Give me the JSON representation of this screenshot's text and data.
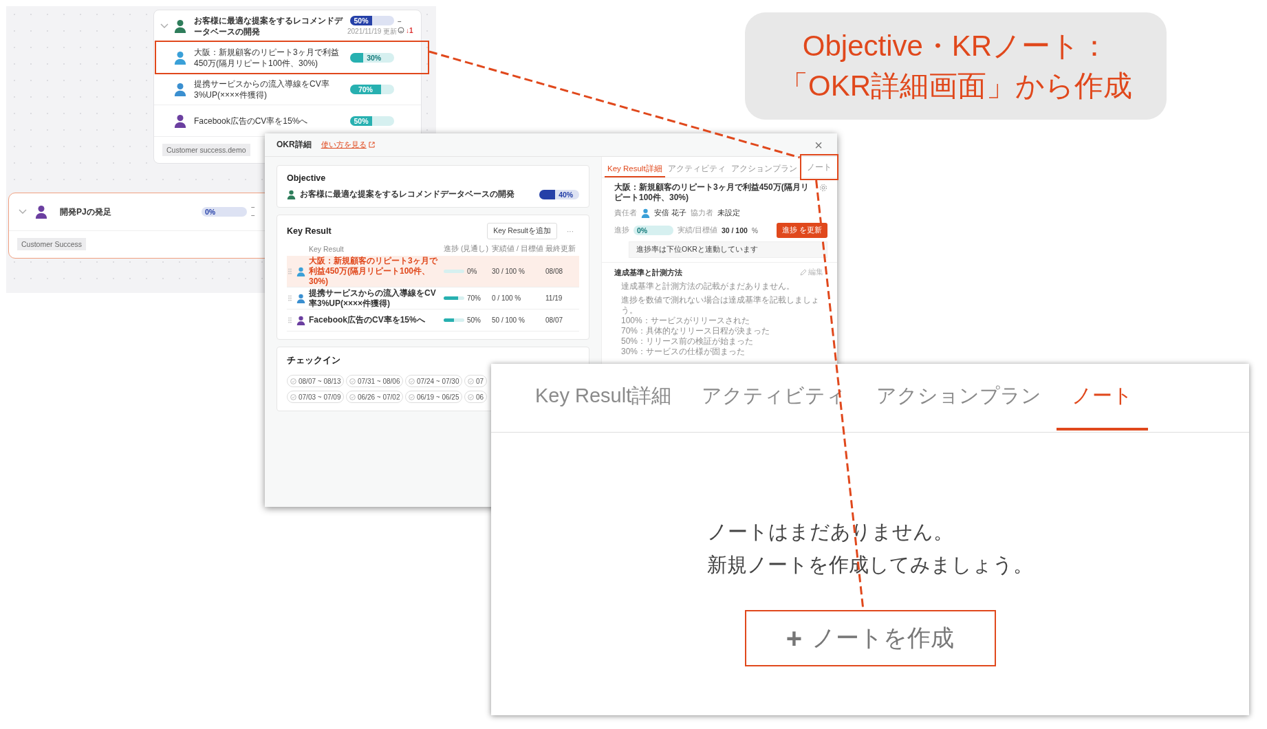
{
  "tree": {
    "objective": {
      "expanded": true,
      "color": "#2e7d5b",
      "title": "お客様に最適な提案をするレコメンドデータベースの開発",
      "progress": "50%",
      "level": 0.5,
      "updated": "2021/11/19 更新",
      "dash": "−",
      "trend": "↓1"
    },
    "key_results": [
      {
        "color": "#3aa0d8",
        "title": "大阪：新規顧客のリピート3ヶ月で利益450万(隔月リピート100件、30%)",
        "progress": "30%",
        "level": 0.3,
        "highlighted": true
      },
      {
        "color": "#3a8fd0",
        "title": "提携サービスからの流入導線をCV率3%UP(××××件獲得)",
        "progress": "70%",
        "level": 0.7,
        "highlighted": false
      },
      {
        "color": "#6b3fa0",
        "title": "Facebook広告のCV率を15%へ",
        "progress": "50%",
        "level": 0.5,
        "highlighted": false
      }
    ],
    "tag": "Customer success.demo"
  },
  "project": {
    "expanded": true,
    "color": "#6b3fa0",
    "title": "開発PJの発足",
    "progress": "0%",
    "level": 0,
    "dashes": [
      "−",
      "−"
    ],
    "tag": "Customer Success"
  },
  "modal": {
    "title": "OKR詳細",
    "help_link": "使い方を見る",
    "close": "×",
    "objective": {
      "heading": "Objective",
      "color": "#2e7d5b",
      "title": "お客様に最適な提案をするレコメンドデータベースの開発",
      "progress": "40%",
      "level": 0.4
    },
    "key_result": {
      "heading": "Key Result",
      "add_button": "Key Resultを追加",
      "more": "···",
      "columns": [
        "Key Result",
        "進捗 (見通し)",
        "実績値 / 目標値",
        "最終更新"
      ],
      "rows": [
        {
          "selected": true,
          "color": "#3aa0d8",
          "title": "大阪：新規顧客のリピート3ヶ月で利益450万(隔月リピート100件、30%)",
          "progress": "0%",
          "level": 0,
          "actual": "30 / 100 %",
          "updated": "08/08"
        },
        {
          "selected": false,
          "color": "#3a8fd0",
          "title": "提携サービスからの流入導線をCV率3%UP(××××件獲得)",
          "progress": "70%",
          "level": 0.7,
          "actual": "0 / 100 %",
          "updated": "11/19"
        },
        {
          "selected": false,
          "color": "#6b3fa0",
          "title": "Facebook広告のCV率を15%へ",
          "progress": "50%",
          "level": 0.5,
          "actual": "50 / 100 %",
          "updated": "08/07"
        }
      ]
    },
    "checkin": {
      "heading": "チェックイン",
      "periods": [
        "08/07 ~ 08/13",
        "07/31 ~ 08/06",
        "07/24 ~ 07/30",
        "07",
        "07/03 ~ 07/09",
        "06/26 ~ 07/02",
        "06/19 ~ 06/25",
        "06"
      ]
    },
    "detail": {
      "tabs": [
        {
          "label": "Key Result詳細",
          "selected": true,
          "highlighted": false
        },
        {
          "label": "アクティビティ",
          "selected": false,
          "highlighted": false
        },
        {
          "label": "アクションプラン",
          "selected": false,
          "highlighted": false
        },
        {
          "label": "ノート",
          "selected": false,
          "highlighted": true
        }
      ],
      "title": "大阪：新規顧客のリピート3ヶ月で利益450万(隔月リピート100件、30%)",
      "owner_label": "責任者",
      "owner": {
        "name": "安倍 花子",
        "color": "#3aa0d8"
      },
      "collaborator_label": "協力者",
      "collaborator": "未設定",
      "progress_label": "進捗",
      "progress": "0%",
      "level": 0,
      "actual_label": "実績/目標値",
      "actual": "30 / 100",
      "unit": "%",
      "update_button": "進捗 を更新",
      "notice": "進捗率は下位OKRと連動しています",
      "criteria_heading": "達成基準と計測方法",
      "edit": "編集",
      "criteria_empty": "達成基準と計測方法の記載がまだありません。",
      "criteria_hint": [
        "進捗を数値で測れない場合は達成基準を記載しましょう。",
        "100%：サービスがリリースされた",
        "70%：具体的なリリース日程が決まった",
        "50%：リリース前の検証が始まった",
        "30%：サービスの仕様が固まった"
      ]
    }
  },
  "note_panel": {
    "tabs": [
      {
        "label": "Key Result詳細",
        "selected": false
      },
      {
        "label": "アクティビティ",
        "selected": false
      },
      {
        "label": "アクションプラン",
        "selected": false
      },
      {
        "label": "ノート",
        "selected": true
      }
    ],
    "empty_lines": [
      "ノートはまだありません。",
      "新規ノートを作成してみましょう。"
    ],
    "create_button": {
      "icon": "+",
      "label": "ノートを作成",
      "highlighted": true
    }
  },
  "callout": {
    "lines": [
      "Objective・KRノート：",
      "「OKR詳細画面」から作成"
    ]
  }
}
